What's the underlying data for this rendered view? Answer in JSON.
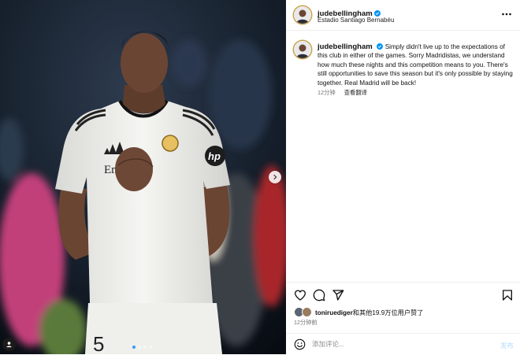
{
  "post": {
    "username": "judebellingham",
    "location": "Estadio Santiago Bernabéu",
    "caption": "Simply didn't live up to the expectations of this club in either of the games. Sorry Madridistas, we understand how much these nights and this competition means to you. There's still opportunities to save this season but it's only possible by staying together. Real Madrid will be back!",
    "time": "12分钟",
    "translate_label": "查看翻译",
    "likes_user": "toniruediger",
    "likes_rest": "和其他19.9万位用户赞了",
    "time_long": "12分钟前"
  },
  "comment": {
    "placeholder": "添加评论...",
    "post_label": "发布"
  },
  "media": {
    "image_description": "Footballer in white Real Madrid kit with HP sponsor, hands clasped, in a dark stadium",
    "jersey_number": "5",
    "sponsor_text": "Emirates",
    "carousel_count": 4,
    "carousel_active": 1
  },
  "colors": {
    "verified": "#0095f6",
    "link_blue": "#b3dbff",
    "carousel_active": "#3b9cf5",
    "avatar_ring": "#c9a34b"
  },
  "icons": [
    "verified-icon",
    "more-options-icon",
    "heart-icon",
    "comment-icon",
    "share-icon",
    "bookmark-icon",
    "emoji-icon",
    "chevron-right-icon",
    "user-tag-icon"
  ]
}
